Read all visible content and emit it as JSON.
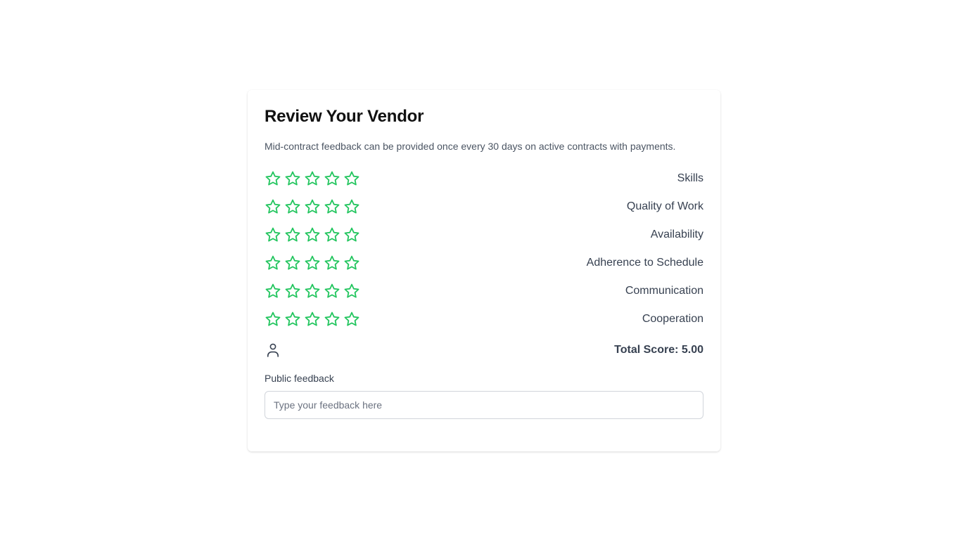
{
  "review": {
    "title": "Review Your Vendor",
    "subtitle": "Mid-contract feedback can be provided once every 30 days on active contracts with payments.",
    "star_color": "#22c55e",
    "max_stars": 5,
    "criteria": [
      {
        "label": "Skills",
        "rating": 0
      },
      {
        "label": "Quality of Work",
        "rating": 0
      },
      {
        "label": "Availability",
        "rating": 0
      },
      {
        "label": "Adherence to Schedule",
        "rating": 0
      },
      {
        "label": "Communication",
        "rating": 0
      },
      {
        "label": "Cooperation",
        "rating": 0
      }
    ],
    "user_icon": "user-icon",
    "total_score_text": "Total Score: 5.00",
    "feedback_label": "Public feedback",
    "feedback_placeholder": "Type your feedback here",
    "feedback_value": ""
  }
}
